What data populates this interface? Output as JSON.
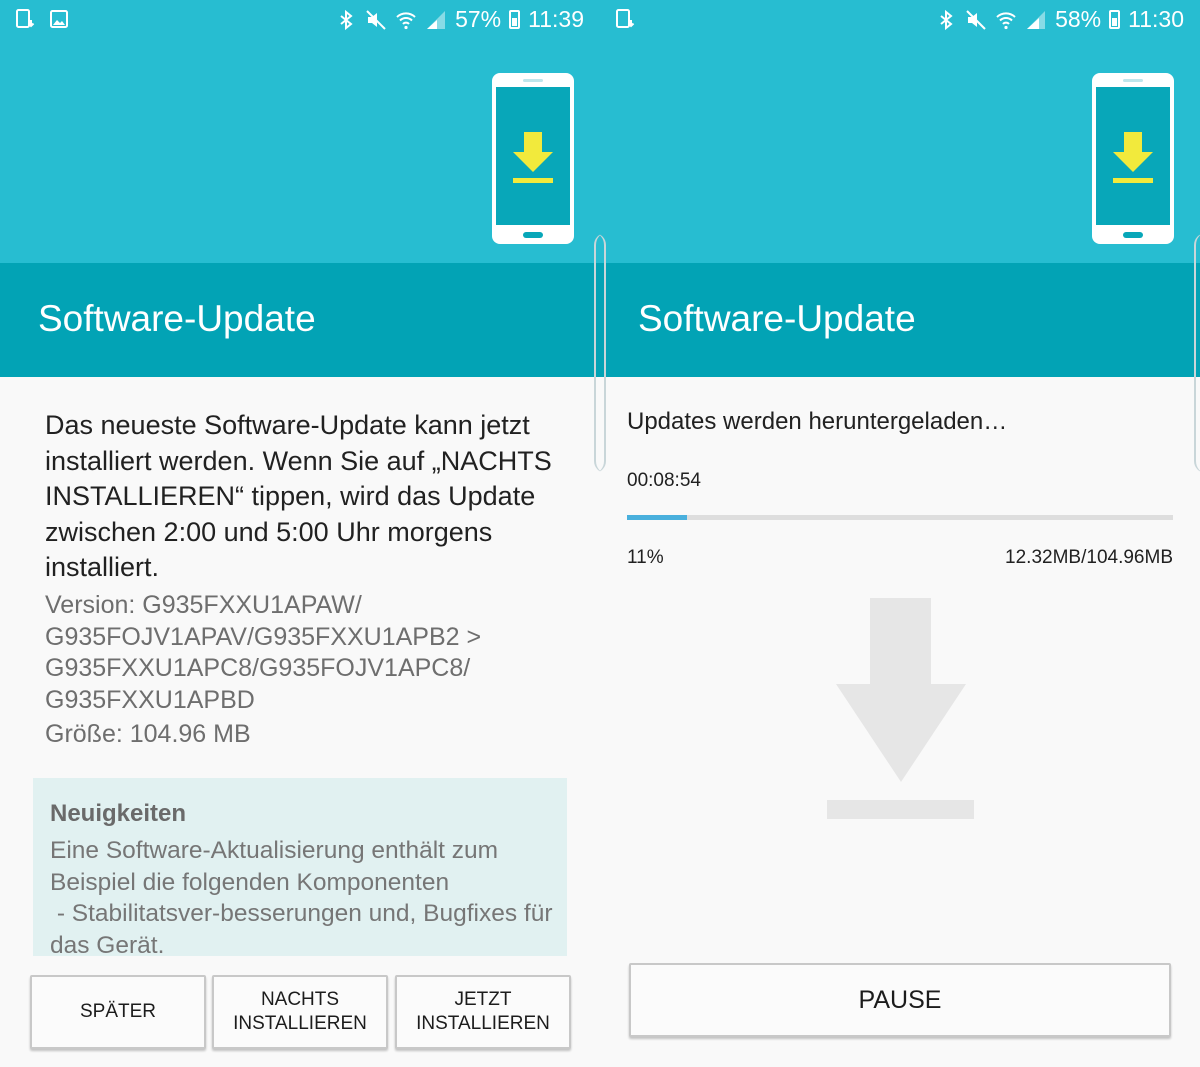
{
  "left": {
    "status": {
      "battery": "57%",
      "time": "11:39"
    },
    "title": "Software-Update",
    "description": "Das neueste Software-Update kann jetzt installiert werden. Wenn Sie auf „NACHTS INSTALLIEREN“ tippen, wird das Update zwischen 2:00 und 5:00 Uhr morgens installiert.",
    "version_lines": [
      "Version: G935FXXU1APAW/",
      "G935FOJV1APAV/G935FXXU1APB2 >",
      "G935FXXU1APC8/G935FOJV1APC8/",
      "G935FXXU1APBD"
    ],
    "size": "Größe: 104.96 MB",
    "news": {
      "title": "Neuigkeiten",
      "body": "Eine Software-Aktualisierung enthält zum Beispiel die folgenden Komponenten\n - Stabilitatsver-besserungen und, Bugfixes für das Gerät."
    },
    "buttons": {
      "later": "SPÄTER",
      "night_line1": "NACHTS",
      "night_line2": "INSTALLIEREN",
      "now_line1": "JETZT",
      "now_line2": "INSTALLIEREN"
    }
  },
  "right": {
    "status": {
      "battery": "58%",
      "time": "11:30"
    },
    "title": "Software-Update",
    "download_status": "Updates werden heruntergeladen…",
    "elapsed": "00:08:54",
    "progress": 0.11,
    "percent": "11%",
    "size_progress": "12.32MB/104.96MB",
    "button_pause": "PAUSE"
  },
  "colors": {
    "hero": "#27bdd1",
    "titlebar": "#02a3b5",
    "arrow_yellow": "#f2ea3c",
    "progress": "#4ab0dd",
    "news_bg": "#e1f1f1"
  },
  "icons": [
    "notification-download-icon",
    "gallery-icon",
    "bluetooth-icon",
    "mute-icon",
    "wifi-icon",
    "signal-icon",
    "battery-icon",
    "phone-download-illustration",
    "download-arrow-icon"
  ]
}
